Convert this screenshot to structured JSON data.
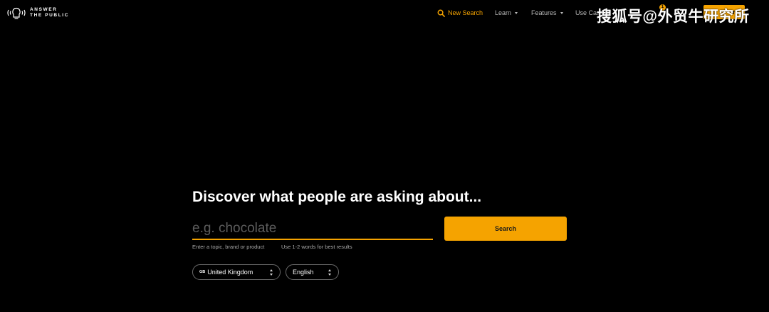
{
  "header": {
    "logo": {
      "line1": "ANSWER",
      "line2": "THE PUBLIC"
    },
    "nav": {
      "new_search": "New Search",
      "learn": "Learn",
      "features": "Features",
      "use_cases": "Use Cas"
    },
    "notification_count": "1",
    "go_pro_label": "ro",
    "watermark": "搜狐号@外贸牛研究所"
  },
  "hero": {
    "headline": "Discover what people are asking about...",
    "search": {
      "placeholder": "e.g. chocolate",
      "value": "",
      "button_label": "Search",
      "hint_left": "Enter a topic, brand or product",
      "hint_right": "Use 1-2 words for best results"
    },
    "country": {
      "flag_code": "GB",
      "selected": "United Kingdom"
    },
    "language": {
      "selected": "English"
    }
  },
  "colors": {
    "accent": "#f5a300",
    "background": "#000000",
    "text": "#ffffff",
    "muted_text": "#a8a8a8"
  },
  "icons": {
    "logo": "lightbulb-head-icon",
    "new_search": "search-icon",
    "dropdown": "chevron-down-icon",
    "select": "up-down-arrows-icon"
  }
}
